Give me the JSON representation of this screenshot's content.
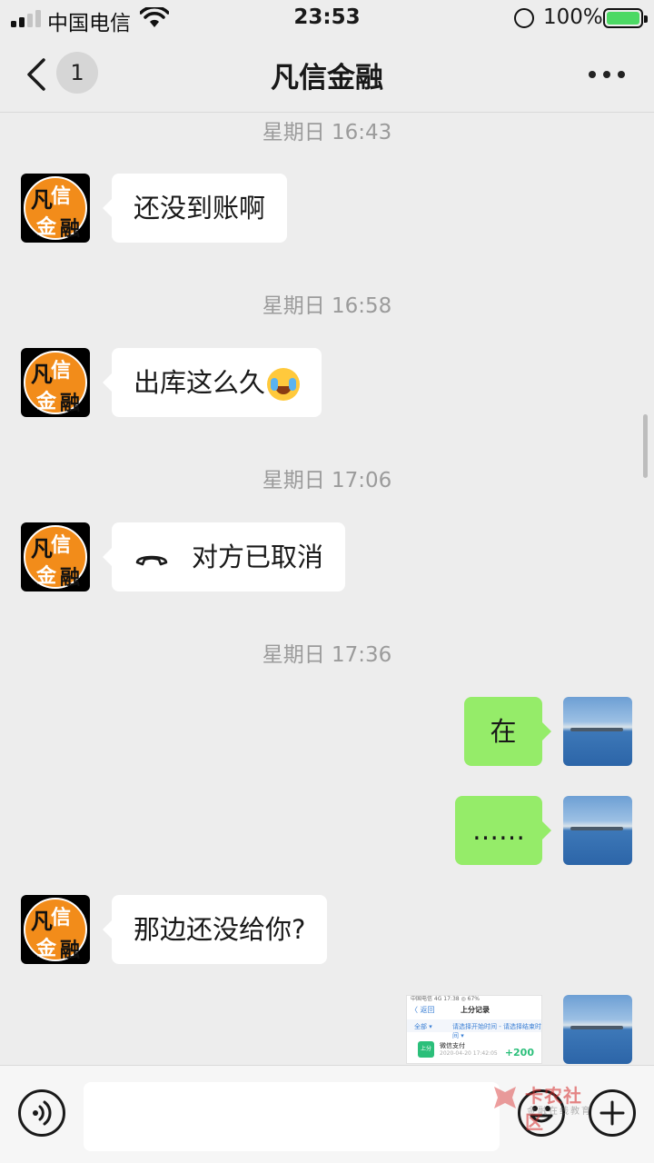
{
  "status_bar": {
    "carrier": "中国电信",
    "time": "23:53",
    "battery_percent": "100%",
    "signal_bars_active": 2,
    "signal_bars_total": 4
  },
  "nav": {
    "back_badge": "1",
    "title": "凡信金融"
  },
  "contact_avatar": {
    "chars": [
      "凡",
      "信",
      "金",
      "融"
    ]
  },
  "timestamps": [
    "星期日 16:43",
    "星期日 16:58",
    "星期日 17:06",
    "星期日 17:36"
  ],
  "messages": [
    {
      "from": "contact",
      "text": "还没到账啊"
    },
    {
      "from": "contact",
      "text": "出库这么久",
      "emoji": "crying-laughing-emoji"
    },
    {
      "from": "contact",
      "type": "call",
      "text": "对方已取消",
      "icon": "phone-hangup-icon"
    },
    {
      "from": "me",
      "text": "在"
    },
    {
      "from": "me",
      "text": "……"
    },
    {
      "from": "contact",
      "text": "那边还没给你?"
    },
    {
      "from": "me",
      "type": "image"
    }
  ],
  "screenshot_thumb": {
    "status": "中国电信  4G            17:38            ◎ 67%",
    "back": "〈 返回",
    "title": "上分记录",
    "filter_all": "全部 ▾",
    "filter_time": "请选择开始时间 - 请选择结束时间 ▾",
    "row_icon": "上分",
    "row_title": "微信支付",
    "row_time": "2020-04-20 17:42:05",
    "row_amount": "+200"
  },
  "watermark": {
    "title": "卡农社区",
    "subtitle": "金融在线教育"
  },
  "colors": {
    "background": "#ededed",
    "outgoing_bubble": "#95ec69",
    "incoming_bubble": "#ffffff",
    "timestamp": "#9b9b9b",
    "battery_fill": "#4cd964"
  }
}
